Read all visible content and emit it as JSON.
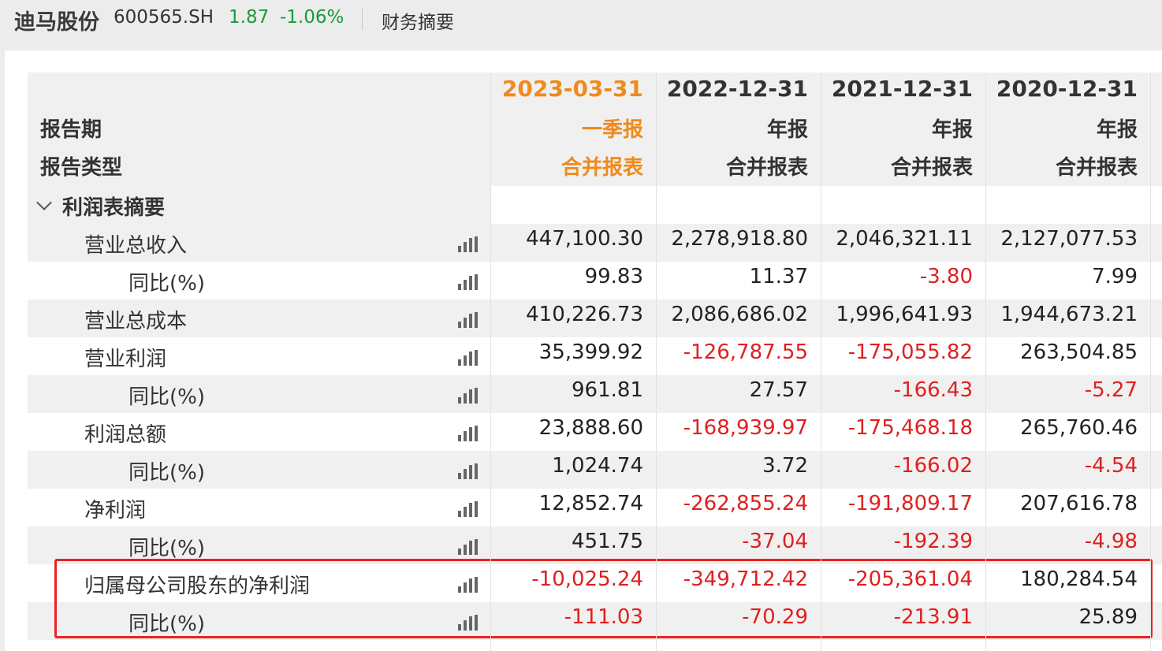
{
  "header": {
    "stock_name": "迪马股份",
    "stock_code": "600565.SH",
    "price": "1.87",
    "change": "-1.06%",
    "tab": "财务摘要"
  },
  "colors": {
    "accent": "#f08a1c",
    "down": "#1a9a3a",
    "negative": "#e02020",
    "highlight": "#e8231e"
  },
  "table": {
    "row_labels": {
      "period": "报告期",
      "type": "报告类型"
    },
    "columns": [
      {
        "date": "2023-03-31",
        "period": "一季报",
        "type": "合并报表"
      },
      {
        "date": "2022-12-31",
        "period": "年报",
        "type": "合并报表"
      },
      {
        "date": "2021-12-31",
        "period": "年报",
        "type": "合并报表"
      },
      {
        "date": "2020-12-31",
        "period": "年报",
        "type": "合并报表"
      }
    ],
    "section": "利润表摘要",
    "rows": [
      {
        "label": "营业总收入",
        "level": 1,
        "values": [
          "447,100.30",
          "2,278,918.80",
          "2,046,321.11",
          "2,127,077.53"
        ]
      },
      {
        "label": "同比(%)",
        "level": 2,
        "values": [
          "99.83",
          "11.37",
          "-3.80",
          "7.99"
        ]
      },
      {
        "label": "营业总成本",
        "level": 1,
        "values": [
          "410,226.73",
          "2,086,686.02",
          "1,996,641.93",
          "1,944,673.21"
        ]
      },
      {
        "label": "营业利润",
        "level": 1,
        "values": [
          "35,399.92",
          "-126,787.55",
          "-175,055.82",
          "263,504.85"
        ]
      },
      {
        "label": "同比(%)",
        "level": 2,
        "values": [
          "961.81",
          "27.57",
          "-166.43",
          "-5.27"
        ]
      },
      {
        "label": "利润总额",
        "level": 1,
        "values": [
          "23,888.60",
          "-168,939.97",
          "-175,468.18",
          "265,760.46"
        ]
      },
      {
        "label": "同比(%)",
        "level": 2,
        "values": [
          "1,024.74",
          "3.72",
          "-166.02",
          "-4.54"
        ]
      },
      {
        "label": "净利润",
        "level": 1,
        "values": [
          "12,852.74",
          "-262,855.24",
          "-191,809.17",
          "207,616.78"
        ]
      },
      {
        "label": "同比(%)",
        "level": 2,
        "values": [
          "451.75",
          "-37.04",
          "-192.39",
          "-4.98"
        ]
      },
      {
        "label": "归属母公司股东的净利润",
        "level": 1,
        "values": [
          "-10,025.24",
          "-349,712.42",
          "-205,361.04",
          "180,284.54"
        ]
      },
      {
        "label": "同比(%)",
        "level": 2,
        "values": [
          "-111.03",
          "-70.29",
          "-213.91",
          "25.89"
        ]
      }
    ]
  }
}
